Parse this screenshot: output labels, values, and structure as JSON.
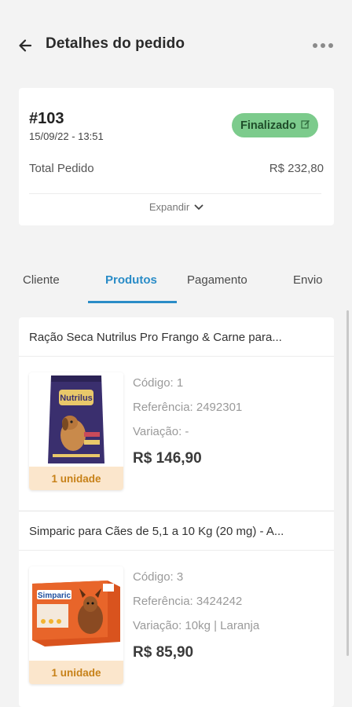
{
  "header": {
    "title": "Detalhes do pedido"
  },
  "order": {
    "number": "#103",
    "date": "15/09/22 - 13:51",
    "status": "Finalizado",
    "total_label": "Total Pedido",
    "total_value": "R$ 232,80",
    "expand_label": "Expandir"
  },
  "tabs": [
    {
      "label": "Cliente"
    },
    {
      "label": "Produtos"
    },
    {
      "label": "Pagamento"
    },
    {
      "label": "Envio"
    }
  ],
  "products": [
    {
      "title": "Ração Seca Nutrilus Pro Frango & Carne para...",
      "codigo": "Código: 1",
      "referencia": "Referência: 2492301",
      "variacao": "Variação: -",
      "price": "R$ 146,90",
      "quantity": "1 unidade",
      "brand": "Nutrilus"
    },
    {
      "title": "Simparic para Cães de 5,1 a 10 Kg (20 mg) - A...",
      "codigo": "Código: 3",
      "referencia": "Referência: 3424242",
      "variacao": "Variação: 10kg | Laranja",
      "price": "R$ 85,90",
      "quantity": "1 unidade",
      "brand": "Simparic"
    }
  ]
}
